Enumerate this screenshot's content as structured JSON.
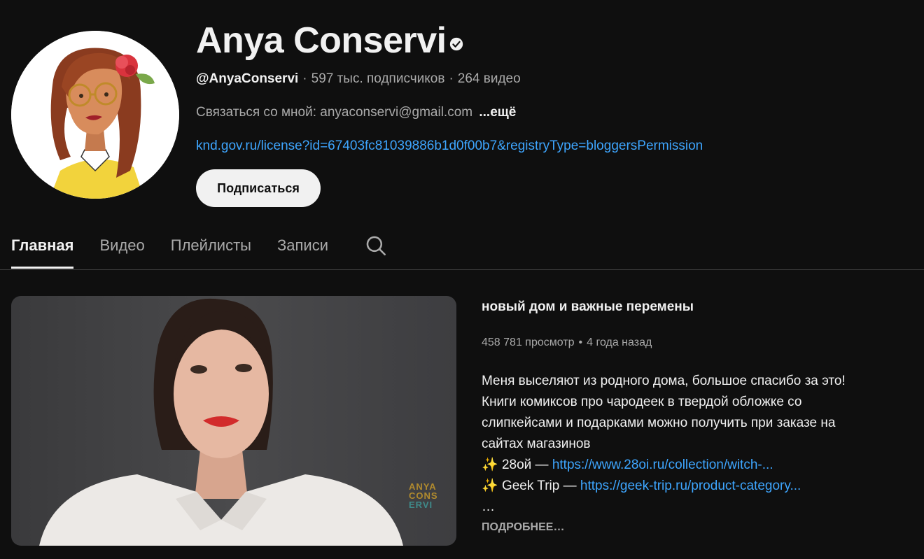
{
  "channel": {
    "name": "Anya Conservi",
    "verified_icon": "verified-check-icon",
    "handle": "@AnyaConservi",
    "separator": "·",
    "subscribers": "597 тыс. подписчиков",
    "videos": "264 видео",
    "description": "Связаться со мной: anyaconservi@gmail.com",
    "more_label": "...ещё",
    "link": "knd.gov.ru/license?id=67403fc81039886b1d0f00b7&registryType=bloggersPermission",
    "subscribe_label": "Подписаться"
  },
  "tabs": [
    {
      "label": "Главная",
      "active": true
    },
    {
      "label": "Видео",
      "active": false
    },
    {
      "label": "Плейлисты",
      "active": false
    },
    {
      "label": "Записи",
      "active": false
    }
  ],
  "search_icon": "search-icon",
  "featured_video": {
    "title": "новый дом и важные перемены",
    "views": "458 781 просмотр",
    "dot": "•",
    "age": "4 года назад",
    "description_lines": [
      "Меня выселяют из родного дома, большое спасибо за это!",
      "Книги комиксов про чародеек в твердой обложке со",
      "слипкейсами и подарками можно получить при заказе на",
      "сайтах магазинов"
    ],
    "shop_lines": [
      {
        "emoji": "✨",
        "name": "28ой —",
        "url": "https://www.28oi.ru/collection/witch-..."
      },
      {
        "emoji": "✨",
        "name": "Geek Trip —",
        "url": "https://geek-trip.ru/product-category..."
      }
    ],
    "ellipsis": "…",
    "read_more_label": "ПОДРОБНЕЕ…",
    "watermark_lines": [
      "ANYA",
      "CONS",
      "ERVI"
    ]
  },
  "colors": {
    "background": "#0f0f0f",
    "text": "#f1f1f1",
    "muted": "#aaaaaa",
    "link": "#3ea6ff"
  }
}
